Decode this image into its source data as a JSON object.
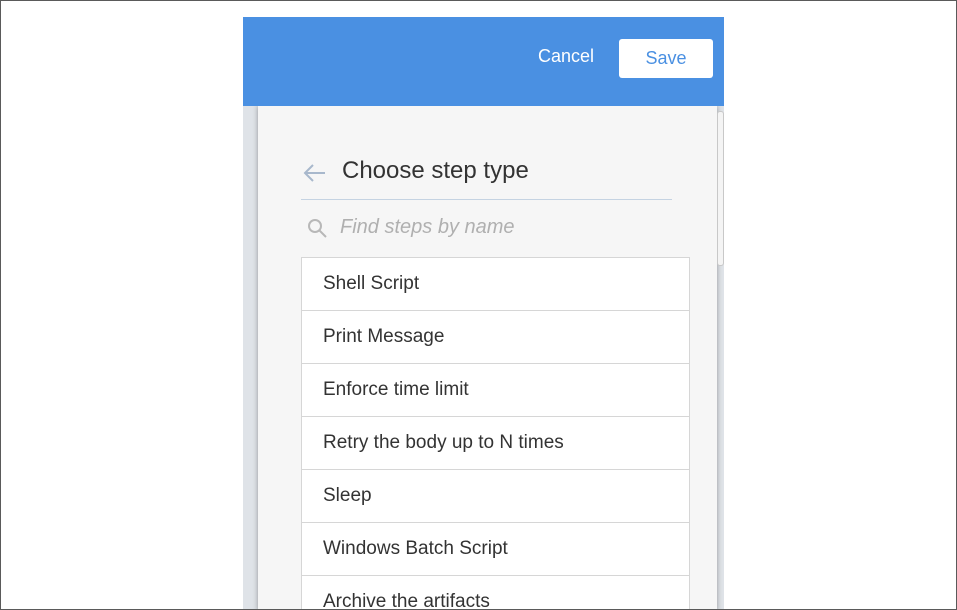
{
  "toolbar": {
    "cancel_label": "Cancel",
    "save_label": "Save"
  },
  "header": {
    "back_icon": "arrow-left-icon",
    "title": "Choose step type"
  },
  "search": {
    "icon": "search-icon",
    "placeholder": "Find steps by name",
    "value": ""
  },
  "steps": [
    {
      "label": "Shell Script"
    },
    {
      "label": "Print Message"
    },
    {
      "label": "Enforce time limit"
    },
    {
      "label": "Retry the body up to N times"
    },
    {
      "label": "Sleep"
    },
    {
      "label": "Windows Batch Script"
    },
    {
      "label": "Archive the artifacts"
    }
  ],
  "colors": {
    "topbar": "#4a90e2",
    "panel_bg": "#f6f6f6",
    "outer_bg": "#dfe3e8",
    "text": "#333333",
    "divider": "#c5d3e2"
  }
}
